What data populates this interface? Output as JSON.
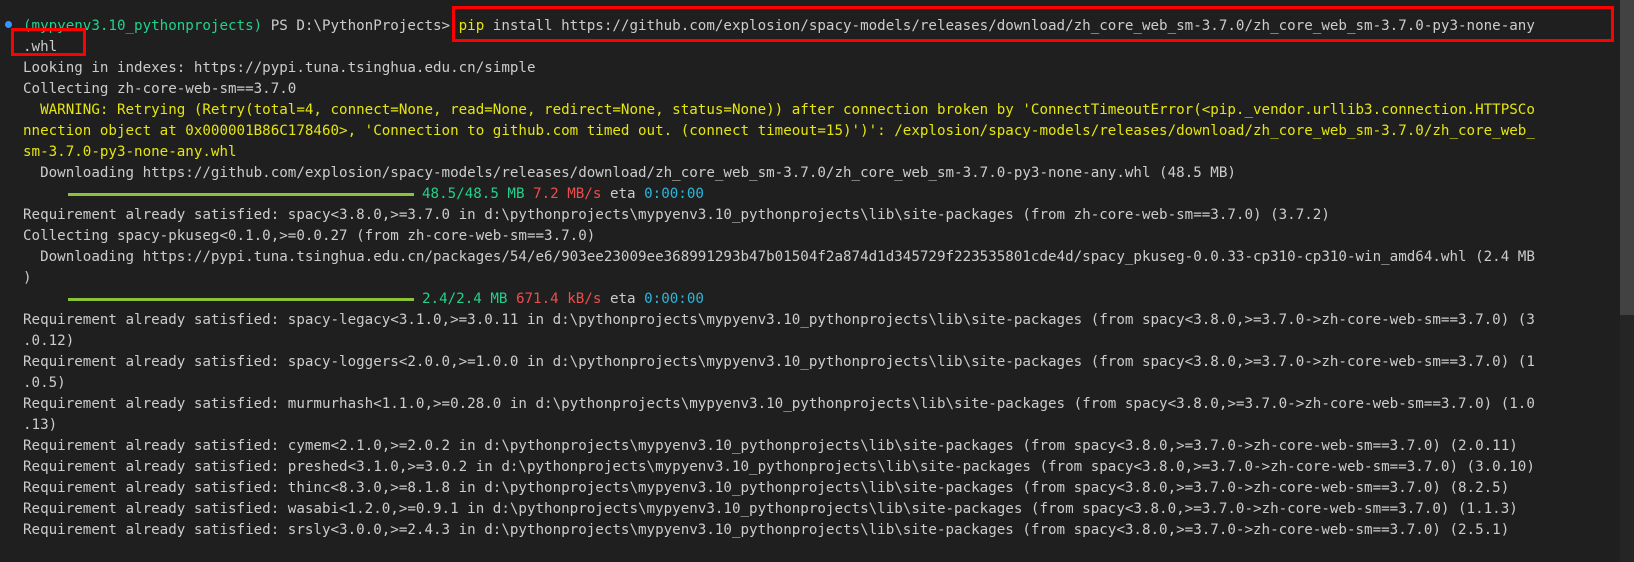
{
  "prompt": {
    "env": "(mypyenv3.10_pythonprojects)",
    "path": "PS D:\\PythonProjects>",
    "cmd": "pip",
    "command_rest": " install https://github.com/explosion/spacy-models/releases/download/zh_core_web_sm-3.7.0/zh_core_web_sm-3.7.0-py3-none-any",
    "command_cont": ".whl"
  },
  "lines": {
    "l3": "Looking in indexes: https://pypi.tuna.tsinghua.edu.cn/simple",
    "l4": "Collecting zh-core-web-sm==3.7.0",
    "l5": "  WARNING: Retrying (Retry(total=4, connect=None, read=None, redirect=None, status=None)) after connection broken by 'ConnectTimeoutError(<pip._vendor.urllib3.connection.HTTPSCo",
    "l6": "nnection object at 0x000001B86C178460>, 'Connection to github.com timed out. (connect timeout=15)')': /explosion/spacy-models/releases/download/zh_core_web_sm-3.7.0/zh_core_web_",
    "l7": "sm-3.7.0-py3-none-any.whl",
    "l8": "  Downloading https://github.com/explosion/spacy-models/releases/download/zh_core_web_sm-3.7.0/zh_core_web_sm-3.7.0-py3-none-any.whl (48.5 MB)",
    "l10": "Requirement already satisfied: spacy<3.8.0,>=3.7.0 in d:\\pythonprojects\\mypyenv3.10_pythonprojects\\lib\\site-packages (from zh-core-web-sm==3.7.0) (3.7.2)",
    "l11": "Collecting spacy-pkuseg<0.1.0,>=0.0.27 (from zh-core-web-sm==3.7.0)",
    "l12": "  Downloading https://pypi.tuna.tsinghua.edu.cn/packages/54/e6/903ee23009ee368991293b47b01504f2a874d1d345729f223535801cde4d/spacy_pkuseg-0.0.33-cp310-cp310-win_amd64.whl (2.4 MB",
    "l13": ")",
    "l15": "Requirement already satisfied: spacy-legacy<3.1.0,>=3.0.11 in d:\\pythonprojects\\mypyenv3.10_pythonprojects\\lib\\site-packages (from spacy<3.8.0,>=3.7.0->zh-core-web-sm==3.7.0) (3",
    "l16": ".0.12)",
    "l17": "Requirement already satisfied: spacy-loggers<2.0.0,>=1.0.0 in d:\\pythonprojects\\mypyenv3.10_pythonprojects\\lib\\site-packages (from spacy<3.8.0,>=3.7.0->zh-core-web-sm==3.7.0) (1",
    "l18": ".0.5)",
    "l19": "Requirement already satisfied: murmurhash<1.1.0,>=0.28.0 in d:\\pythonprojects\\mypyenv3.10_pythonprojects\\lib\\site-packages (from spacy<3.8.0,>=3.7.0->zh-core-web-sm==3.7.0) (1.0",
    "l20": ".13)",
    "l21": "Requirement already satisfied: cymem<2.1.0,>=2.0.2 in d:\\pythonprojects\\mypyenv3.10_pythonprojects\\lib\\site-packages (from spacy<3.8.0,>=3.7.0->zh-core-web-sm==3.7.0) (2.0.11)",
    "l22": "Requirement already satisfied: preshed<3.1.0,>=3.0.2 in d:\\pythonprojects\\mypyenv3.10_pythonprojects\\lib\\site-packages (from spacy<3.8.0,>=3.7.0->zh-core-web-sm==3.7.0) (3.0.10)",
    "l23": "Requirement already satisfied: thinc<8.3.0,>=8.1.8 in d:\\pythonprojects\\mypyenv3.10_pythonprojects\\lib\\site-packages (from spacy<3.8.0,>=3.7.0->zh-core-web-sm==3.7.0) (8.2.5)",
    "l24": "Requirement already satisfied: wasabi<1.2.0,>=0.9.1 in d:\\pythonprojects\\mypyenv3.10_pythonprojects\\lib\\site-packages (from spacy<3.8.0,>=3.7.0->zh-core-web-sm==3.7.0) (1.1.3)",
    "l25": "Requirement already satisfied: srsly<3.0.0,>=2.4.3 in d:\\pythonprojects\\mypyenv3.10_pythonprojects\\lib\\site-packages (from spacy<3.8.0,>=3.7.0->zh-core-web-sm==3.7.0) (2.5.1)"
  },
  "progress1": {
    "size": "48.5/48.5 MB",
    "speed": "7.2 MB/s",
    "eta_label": "eta",
    "eta": "0:00:00",
    "fraction": 1.0
  },
  "progress2": {
    "size": "2.4/2.4 MB",
    "speed": "671.4 kB/s",
    "eta_label": "eta",
    "eta": "0:00:00",
    "fraction": 1.0
  },
  "colors": {
    "background": "#1f1f1f",
    "text": "#cccccc",
    "green": "#23d18b",
    "yellow": "#e5e510",
    "cyan": "#29b8db",
    "red": "#f14c4c",
    "bar": "#8ac23a",
    "annotation_box": "#ff0000"
  }
}
